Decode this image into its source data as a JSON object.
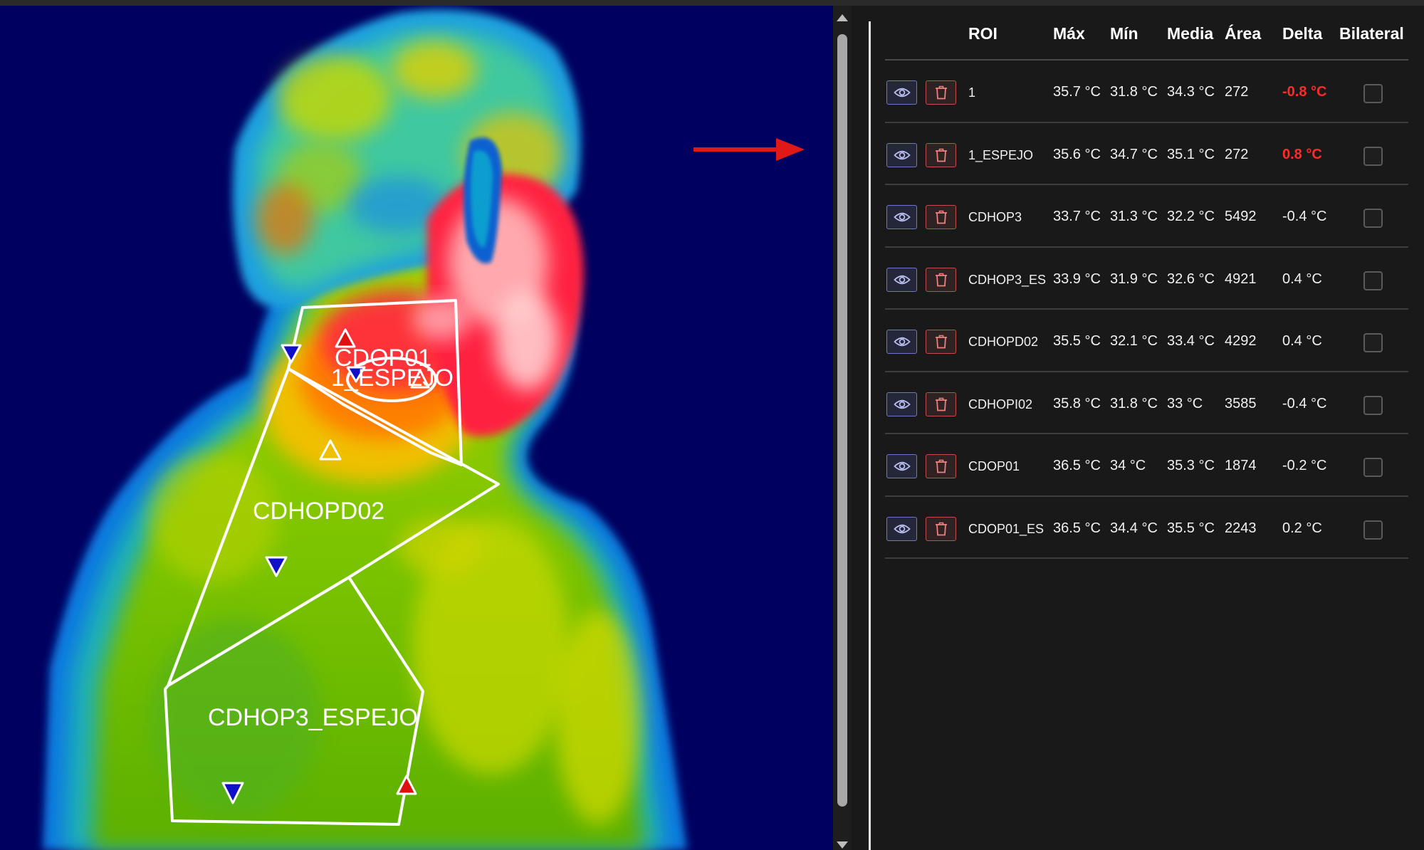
{
  "image": {
    "roi_labels": [
      "CDOP01",
      "1_ESPEJO",
      "CDHOPD02",
      "CDHOP3_ESPEJO"
    ]
  },
  "table": {
    "headers": [
      "ROI",
      "Máx",
      "Mín",
      "Media",
      "Área",
      "Delta",
      "Bilateral"
    ],
    "rows": [
      {
        "name": "1",
        "max": "35.7 °C",
        "min": "31.8 °C",
        "mean": "34.3 °C",
        "area": "272",
        "delta": "-0.8 °C",
        "highlight": true
      },
      {
        "name": "1_ESPEJO",
        "max": "35.6 °C",
        "min": "34.7 °C",
        "mean": "35.1 °C",
        "area": "272",
        "delta": "0.8 °C",
        "highlight": true
      },
      {
        "name": "CDHOP3",
        "max": "33.7 °C",
        "min": "31.3 °C",
        "mean": "32.2 °C",
        "area": "5492",
        "delta": "-0.4 °C",
        "highlight": false
      },
      {
        "name": "CDHOP3_ES",
        "max": "33.9 °C",
        "min": "31.9 °C",
        "mean": "32.6 °C",
        "area": "4921",
        "delta": "0.4 °C",
        "highlight": false
      },
      {
        "name": "CDHOPD02",
        "max": "35.5 °C",
        "min": "32.1 °C",
        "mean": "33.4 °C",
        "area": "4292",
        "delta": "0.4 °C",
        "highlight": false
      },
      {
        "name": "CDHOPI02",
        "max": "35.8 °C",
        "min": "31.8 °C",
        "mean": "33 °C",
        "area": "3585",
        "delta": "-0.4 °C",
        "highlight": false
      },
      {
        "name": "CDOP01",
        "max": "36.5 °C",
        "min": "34 °C",
        "mean": "35.3 °C",
        "area": "1874",
        "delta": "-0.2 °C",
        "highlight": false
      },
      {
        "name": "CDOP01_ES",
        "max": "36.5 °C",
        "min": "34.4 °C",
        "mean": "35.5 °C",
        "area": "2243",
        "delta": "0.2 °C",
        "highlight": false
      }
    ]
  },
  "icons": {
    "view": "eye-icon",
    "delete": "trash-icon",
    "arrow": "arrow-right-icon"
  },
  "colors": {
    "background": "#191919",
    "thermal_background": "#000060",
    "delta_highlight": "#ff2a2a",
    "view_button": "#6f76c9",
    "delete_button": "#c44d4d",
    "roi_outline": "#ffffff",
    "max_marker": "#e01010",
    "min_marker": "#1010c8"
  }
}
